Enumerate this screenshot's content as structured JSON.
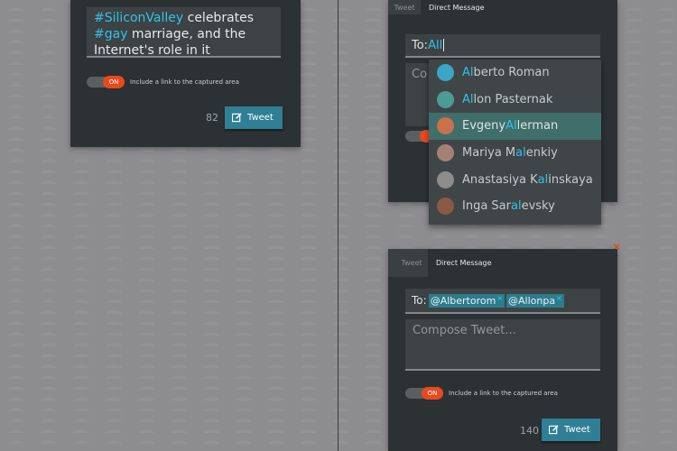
{
  "left_card": {
    "tweet_parts": [
      "#SiliconValley",
      " celebrates ",
      "#gay",
      " marriage, and the Internet's role in it"
    ],
    "toggle_on": "ON",
    "toggle_label": "Include a link to the captured area",
    "count": "82",
    "tweet_button": "Tweet"
  },
  "dm_card": {
    "tab_tweet": "Tweet",
    "tab_dm": "Direct Message",
    "to_label": "To:",
    "to_typed": "All",
    "compose_partial": "Co"
  },
  "suggestions": [
    {
      "pre": "",
      "hl": "Al",
      "post": "berto Roman",
      "avatar_color": "#3aa5c4",
      "active": false
    },
    {
      "pre": "",
      "hl": "Al",
      "post": "lon Pasternak",
      "avatar_color": "#4c9c96",
      "active": false
    },
    {
      "pre": "Evgeny ",
      "hl": "Al",
      "post": "lerman",
      "avatar_color": "#c9714b",
      "active": true
    },
    {
      "pre": "Mariya M",
      "hl": "al",
      "post": "enkiy",
      "avatar_color": "#a48177",
      "active": false
    },
    {
      "pre": "Anastasiya K",
      "hl": "al",
      "post": "inskaya",
      "avatar_color": "#8c8c8c",
      "active": false
    },
    {
      "pre": "Inga Sar",
      "hl": "al",
      "post": "evsky",
      "avatar_color": "#8a5a45",
      "active": false
    }
  ],
  "compose_card": {
    "tab_tweet": "Tweet",
    "tab_dm": "Direct Message",
    "to_label": "To:",
    "chips": [
      "@Albertorom",
      "@Allonpa"
    ],
    "chip_remove": "×",
    "compose_placeholder": "Compose Tweet...",
    "toggle_on": "ON",
    "toggle_label": "Include a link to the captured area",
    "count": "140",
    "tweet_button": "Tweet"
  },
  "close_glyph": "✕",
  "colors": {
    "accent": "#31c3e8",
    "toggle_on": "#e8491d",
    "tweet_button": "#2f7f96",
    "highlight_row": "#3f6e6b"
  }
}
